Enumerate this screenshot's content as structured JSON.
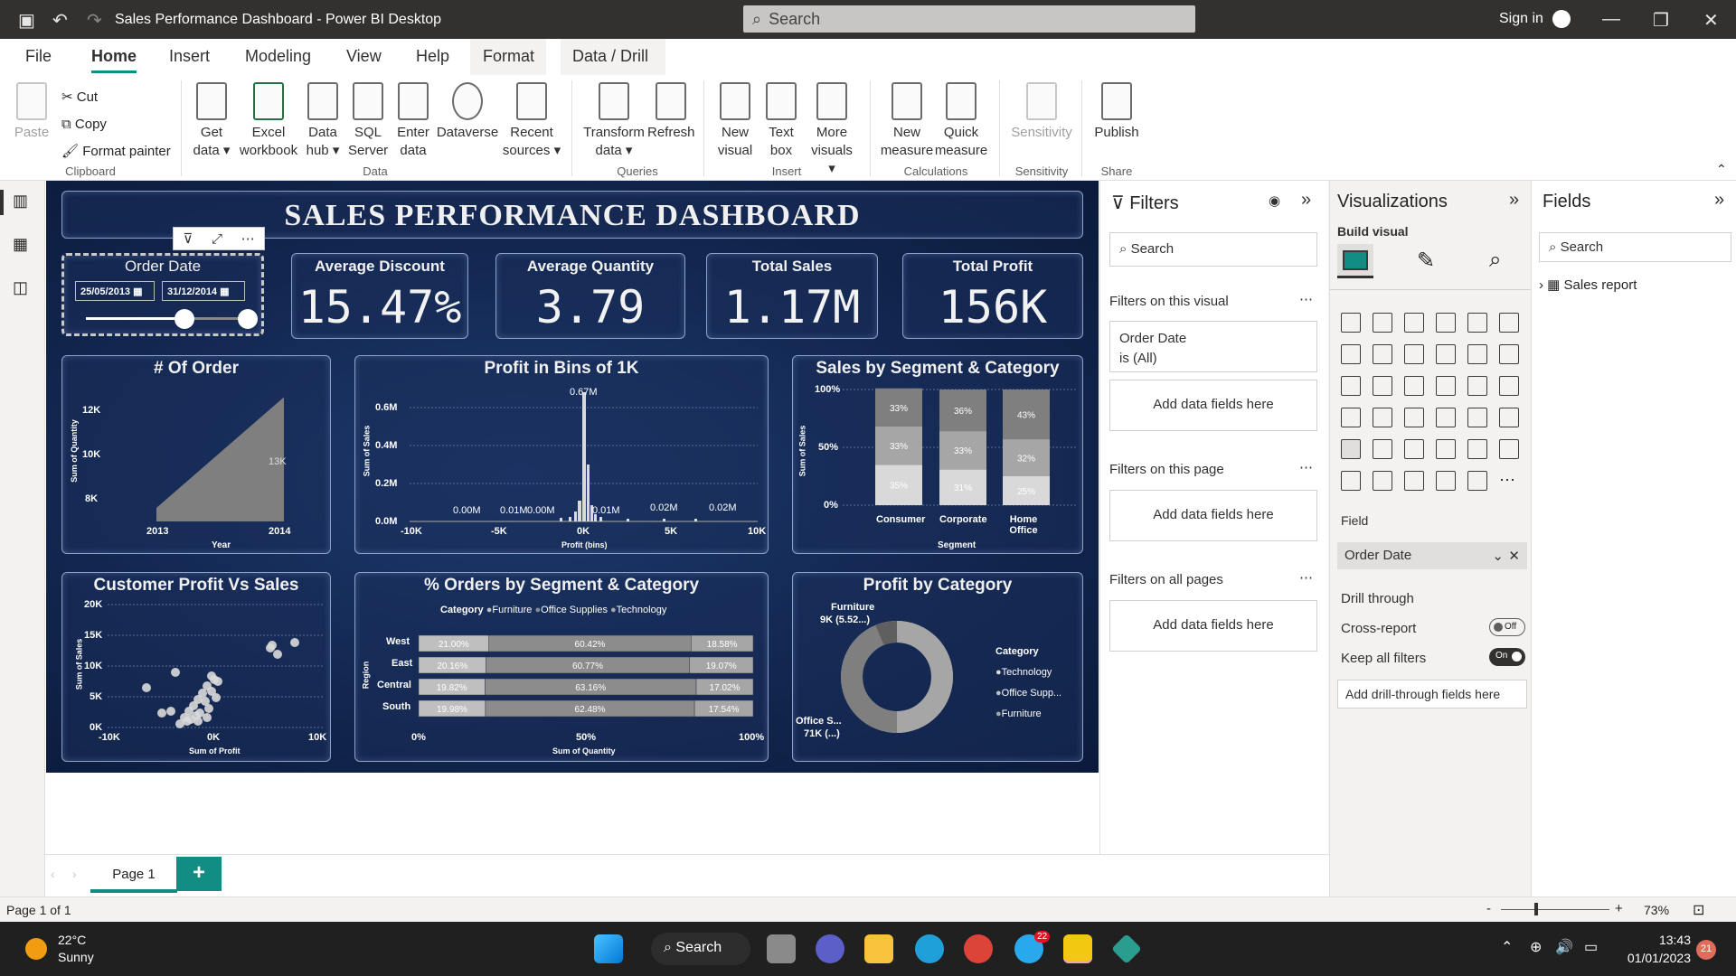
{
  "window": {
    "title": "Sales Performance Dashboard - Power BI Desktop",
    "search": "Search",
    "signin": "Sign in"
  },
  "tabs": [
    "File",
    "Home",
    "Insert",
    "Modeling",
    "View",
    "Help",
    "Format",
    "Data / Drill"
  ],
  "ribbon": {
    "paste": "Paste",
    "cut": "Cut",
    "copy": "Copy",
    "format_painter": "Format painter",
    "clipboard": "Clipboard",
    "get_data": "Get data",
    "excel": "Excel workbook",
    "data_hub": "Data hub",
    "sql": "SQL Server",
    "enter_data": "Enter data",
    "dataverse": "Dataverse",
    "recent": "Recent sources",
    "data_group": "Data",
    "transform": "Transform data",
    "refresh": "Refresh",
    "queries": "Queries",
    "new_visual": "New visual",
    "text_box": "Text box",
    "more_visuals": "More visuals",
    "insert": "Insert",
    "new_measure": "New measure",
    "quick_measure": "Quick measure",
    "calculations": "Calculations",
    "sensitivity": "Sensitivity",
    "sensitivity_group": "Sensitivity",
    "publish": "Publish",
    "share": "Share"
  },
  "dashboard": {
    "title": "SALES PERFORMANCE DASHBOARD",
    "slicer": {
      "label": "Order Date",
      "from": "25/05/2013",
      "to": "31/12/2014"
    },
    "kpis": [
      {
        "label": "Average Discount",
        "value": "15.47%"
      },
      {
        "label": "Average Quantity",
        "value": "3.79"
      },
      {
        "label": "Total Sales",
        "value": "1.17M"
      },
      {
        "label": "Total Profit",
        "value": "156K"
      }
    ]
  },
  "chart_data": [
    {
      "type": "area",
      "title": "# Of Order",
      "xlabel": "Year",
      "ylabel": "Sum of Quantity",
      "x": [
        "2013",
        "2014"
      ],
      "values": [
        7600,
        12500
      ],
      "yticks": [
        "8K",
        "10K",
        "12K"
      ],
      "data_label": "13K"
    },
    {
      "type": "bar",
      "title": "Profit in Bins of 1K",
      "xlabel": "Profit (bins)",
      "ylabel": "Sum of Sales",
      "xticks": [
        "-10K",
        "-5K",
        "0K",
        "5K",
        "10K"
      ],
      "yticks": [
        "0.0M",
        "0.2M",
        "0.4M",
        "0.6M"
      ],
      "data_labels": [
        "0.67M",
        "0.00M",
        "0.01M",
        "0.00M",
        "0.01M",
        "0.02M",
        "0.02M"
      ]
    },
    {
      "type": "bar",
      "title": "Sales by Segment & Category",
      "xlabel": "Segment",
      "ylabel": "Sum of Sales",
      "categories": [
        "Consumer",
        "Corporate",
        "Home Office"
      ],
      "yticks": [
        "0%",
        "50%",
        "100%"
      ],
      "series": [
        {
          "values": [
            "35%",
            "31%",
            "25%"
          ],
          "color": "#d9d9d9"
        },
        {
          "values": [
            "33%",
            "33%",
            "32%"
          ],
          "color": "#a6a6a6"
        },
        {
          "values": [
            "33%",
            "36%",
            "43%"
          ],
          "color": "#7f7f7f"
        }
      ]
    },
    {
      "type": "scatter",
      "title": "Customer Profit Vs Sales",
      "xlabel": "Sum of Profit",
      "ylabel": "Sum of Sales",
      "xticks": [
        "-10K",
        "0K",
        "10K"
      ],
      "yticks": [
        "0K",
        "5K",
        "10K",
        "15K",
        "20K"
      ]
    },
    {
      "type": "bar",
      "title": "% Orders by Segment & Category",
      "xlabel": "Sum of Quantity",
      "ylabel": "Region",
      "legend_title": "Category",
      "legend": [
        "Furniture",
        "Office Supplies",
        "Technology"
      ],
      "categories": [
        "West",
        "East",
        "Central",
        "South"
      ],
      "xticks": [
        "0%",
        "50%",
        "100%"
      ],
      "series": [
        {
          "name": "Furniture",
          "values": [
            21.0,
            20.16,
            19.82,
            19.98
          ],
          "labels": [
            "21.00%",
            "20.16%",
            "19.82%",
            "19.98%"
          ],
          "color": "#bfbfbf"
        },
        {
          "name": "Office Supplies",
          "values": [
            60.42,
            60.77,
            63.16,
            62.48
          ],
          "labels": [
            "60.42%",
            "60.77%",
            "63.16%",
            "62.48%"
          ],
          "color": "#8c8c8c"
        },
        {
          "name": "Technology",
          "values": [
            18.58,
            19.07,
            17.02,
            17.54
          ],
          "labels": [
            "18.58%",
            "19.07%",
            "17.02%",
            "17.54%"
          ],
          "color": "#a6a6a6"
        }
      ]
    },
    {
      "type": "pie",
      "title": "Profit by Category",
      "legend_title": "Category",
      "legend": [
        "Technology",
        "Office Supp...",
        "Furniture"
      ],
      "labels": [
        {
          "name": "Furniture",
          "value": "9K (5.52...)"
        },
        {
          "name": "Office S...",
          "value": "71K (...)"
        }
      ]
    }
  ],
  "filters": {
    "title": "Filters",
    "search": "Search",
    "on_visual": "Filters on this visual",
    "card_field": "Order Date",
    "card_value": "is (All)",
    "add": "Add data fields here",
    "on_page": "Filters on this page",
    "on_all": "Filters on all pages"
  },
  "viz": {
    "title": "Visualizations",
    "build": "Build visual",
    "field": "Field",
    "field_value": "Order Date",
    "drill": "Drill through",
    "cross": "Cross-report",
    "cross_state": "Off",
    "keep": "Keep all filters",
    "keep_state": "On",
    "add_drill": "Add drill-through fields here"
  },
  "fields": {
    "title": "Fields",
    "search": "Search",
    "table": "Sales report"
  },
  "pages": {
    "tab": "Page 1",
    "add": "+"
  },
  "status": {
    "page": "Page 1 of 1",
    "zoom": "73%"
  },
  "taskbar": {
    "temp": "22°C",
    "weather": "Sunny",
    "search": "Search",
    "time": "13:43",
    "date": "01/01/2023",
    "badge": "21",
    "telegram_badge": "22"
  }
}
